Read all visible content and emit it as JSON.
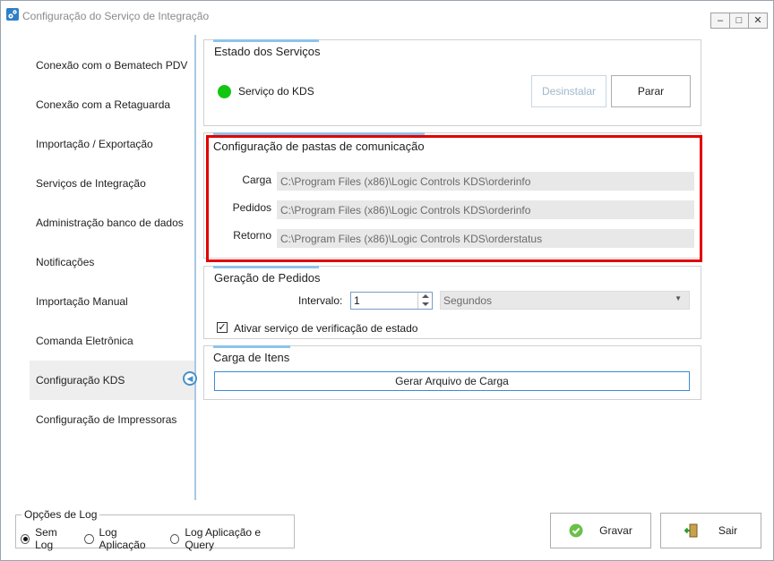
{
  "window": {
    "title": "Configuração do Serviço de Integração",
    "controls": {
      "minimize": "–",
      "maximize": "□",
      "close": "✕"
    }
  },
  "sidebar": {
    "items": [
      {
        "label": "Conexão com o Bematech PDV"
      },
      {
        "label": "Conexão com a Retaguarda"
      },
      {
        "label": "Importação / Exportação"
      },
      {
        "label": "Serviços de Integração"
      },
      {
        "label": "Administração banco de dados"
      },
      {
        "label": "Notificações"
      },
      {
        "label": "Importação Manual"
      },
      {
        "label": "Comanda Eletrônica"
      },
      {
        "label": "Configuração KDS",
        "active": true
      },
      {
        "label": "Configuração de Impressoras"
      }
    ]
  },
  "estado": {
    "title": "Estado dos Serviços",
    "service_label": "Serviço do KDS",
    "status_color": "#11c611",
    "uninstall_label": "Desinstalar",
    "stop_label": "Parar"
  },
  "pastas": {
    "title": "Configuração de pastas de comunicação",
    "carga_label": "Carga",
    "carga_value": "C:\\Program Files (x86)\\Logic Controls KDS\\orderinfo",
    "pedidos_label": "Pedidos",
    "pedidos_value": "C:\\Program Files (x86)\\Logic Controls KDS\\orderinfo",
    "retorno_label": "Retorno",
    "retorno_value": "C:\\Program Files (x86)\\Logic Controls KDS\\orderstatus"
  },
  "geracao": {
    "title": "Geração de Pedidos",
    "interval_label": "Intervalo:",
    "interval_value": "1",
    "unit_value": "Segundos",
    "check_label": "Ativar serviço de verificação de estado",
    "checked": true
  },
  "carga_itens": {
    "title": "Carga de Itens",
    "button_label": "Gerar Arquivo de Carga"
  },
  "log": {
    "legend": "Opções de Log",
    "options": [
      {
        "label": "Sem Log",
        "selected": true
      },
      {
        "label": "Log Aplicação",
        "selected": false
      },
      {
        "label": "Log Aplicação e Query",
        "selected": false
      }
    ]
  },
  "footer": {
    "save_label": "Gravar",
    "exit_label": "Sair"
  },
  "colors": {
    "accent": "#8ec3ea",
    "highlight": "#e00000"
  }
}
